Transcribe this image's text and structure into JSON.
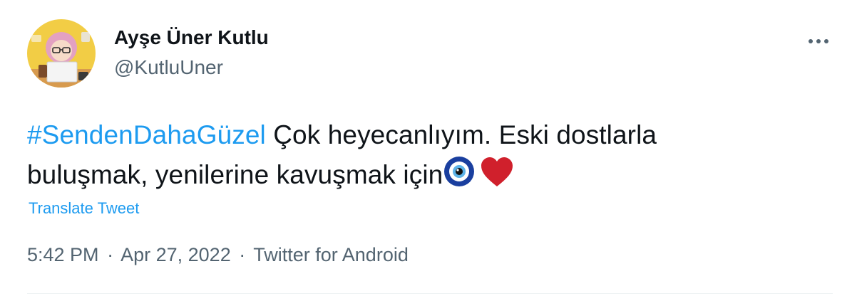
{
  "author": {
    "display_name": "Ayşe Üner Kutlu",
    "handle": "@KutluUner"
  },
  "tweet": {
    "hashtag": "#SendenDahaGüzel",
    "text_line1": " Çok heyecanlıyım. Eski dostlarla",
    "text_line2": "buluşmak, yenilerine kavuşmak için",
    "emojis": [
      "nazar-amulet-icon",
      "red-heart-icon"
    ],
    "translate_label": "Translate Tweet"
  },
  "meta": {
    "time": "5:42 PM",
    "separator": "·",
    "date": "Apr 27, 2022",
    "source": "Twitter for Android"
  },
  "more_icon": "more-horizontal-icon",
  "colors": {
    "link": "#1d9bf0",
    "text": "#0f1419",
    "secondary": "#536471",
    "heart": "#d0202c",
    "nazar_blue": "#1a3f9f"
  }
}
